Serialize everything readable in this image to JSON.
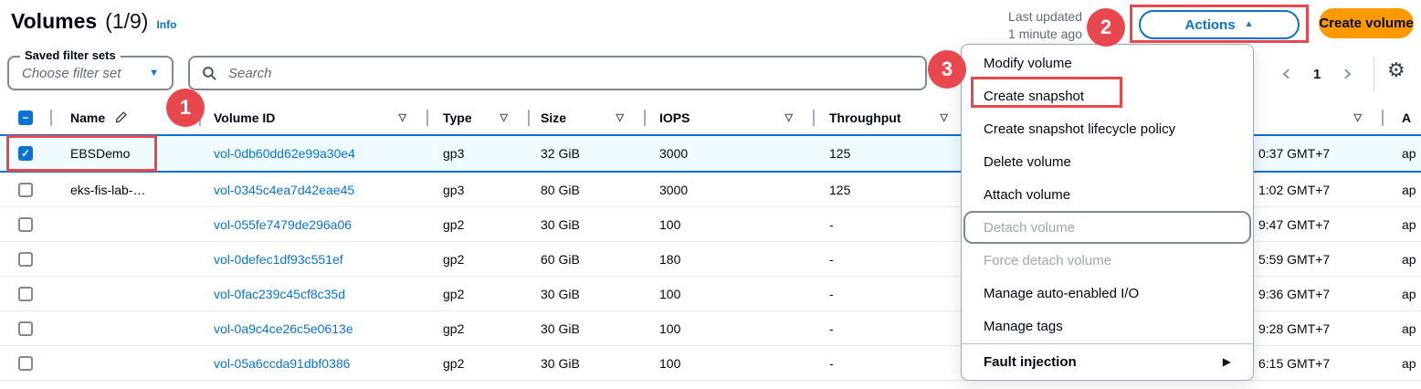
{
  "header": {
    "title": "Volumes",
    "count": "(1/9)",
    "info_label": "Info",
    "last_updated_line1": "Last updated",
    "last_updated_line2": "1 minute ago",
    "actions_label": "Actions",
    "create_volume_label": "Create volume"
  },
  "filters": {
    "saved_filter_sets_label": "Saved filter sets",
    "filter_select_value": "Choose filter set",
    "search_placeholder": "Search"
  },
  "pagination": {
    "page": "1"
  },
  "table": {
    "columns": [
      {
        "label": "Name"
      },
      {
        "label": "Volume ID"
      },
      {
        "label": "Type"
      },
      {
        "label": "Size"
      },
      {
        "label": "IOPS"
      },
      {
        "label": "Throughput"
      },
      {
        "label": ""
      },
      {
        "label": "A"
      }
    ],
    "rows": [
      {
        "selected": true,
        "checked": true,
        "name": "EBSDemo",
        "volume_id": "vol-0db60dd62e99a30e4",
        "type": "gp3",
        "size": "32 GiB",
        "iops": "3000",
        "throughput": "125",
        "created": "0:37 GMT+7",
        "az": "ap"
      },
      {
        "selected": false,
        "checked": false,
        "name": "eks-fis-lab-…",
        "volume_id": "vol-0345c4ea7d42eae45",
        "type": "gp3",
        "size": "80 GiB",
        "iops": "3000",
        "throughput": "125",
        "created": "1:02 GMT+7",
        "az": "ap"
      },
      {
        "selected": false,
        "checked": false,
        "name": "",
        "volume_id": "vol-055fe7479de296a06",
        "type": "gp2",
        "size": "30 GiB",
        "iops": "100",
        "throughput": "-",
        "created": "9:47 GMT+7",
        "az": "ap"
      },
      {
        "selected": false,
        "checked": false,
        "name": "",
        "volume_id": "vol-0defec1df93c551ef",
        "type": "gp2",
        "size": "60 GiB",
        "iops": "180",
        "throughput": "-",
        "created": "5:59 GMT+7",
        "az": "ap"
      },
      {
        "selected": false,
        "checked": false,
        "name": "",
        "volume_id": "vol-0fac239c45cf8c35d",
        "type": "gp2",
        "size": "30 GiB",
        "iops": "100",
        "throughput": "-",
        "created": "9:36 GMT+7",
        "az": "ap"
      },
      {
        "selected": false,
        "checked": false,
        "name": "",
        "volume_id": "vol-0a9c4ce26c5e0613e",
        "type": "gp2",
        "size": "30 GiB",
        "iops": "100",
        "throughput": "-",
        "created": "9:28 GMT+7",
        "az": "ap"
      },
      {
        "selected": false,
        "checked": false,
        "name": "",
        "volume_id": "vol-05a6ccda91dbf0386",
        "type": "gp2",
        "size": "30 GiB",
        "iops": "100",
        "throughput": "-",
        "created": "6:15 GMT+7",
        "az": "ap"
      }
    ]
  },
  "menu": {
    "items": [
      {
        "label": "Modify volume",
        "enabled": true
      },
      {
        "label": "Create snapshot",
        "enabled": true,
        "highlighted": true
      },
      {
        "label": "Create snapshot lifecycle policy",
        "enabled": true
      },
      {
        "label": "Delete volume",
        "enabled": true
      },
      {
        "label": "Attach volume",
        "enabled": true
      },
      {
        "label": "Detach volume",
        "enabled": false,
        "focused": true
      },
      {
        "label": "Force detach volume",
        "enabled": false
      },
      {
        "label": "Manage auto-enabled I/O",
        "enabled": true
      },
      {
        "label": "Manage tags",
        "enabled": true
      },
      {
        "label": "Fault injection",
        "enabled": true,
        "bold": true,
        "submenu": true,
        "divider_above": true
      }
    ]
  },
  "annotations": {
    "badges": [
      "1",
      "2",
      "3"
    ]
  },
  "icons": {
    "sort": "▽",
    "caret_down": "▼",
    "caret_up": "▲",
    "check": "✓",
    "indeterminate": "−",
    "gear": "⚙",
    "submenu": "▶"
  },
  "colors": {
    "accent_blue": "#0972d3",
    "button_orange": "#ff9900",
    "annotation_red": "#e8484d",
    "selected_row_bg": "#f0fbff",
    "disabled_text": "#9ba7b6",
    "muted_text": "#5f6b7a"
  }
}
